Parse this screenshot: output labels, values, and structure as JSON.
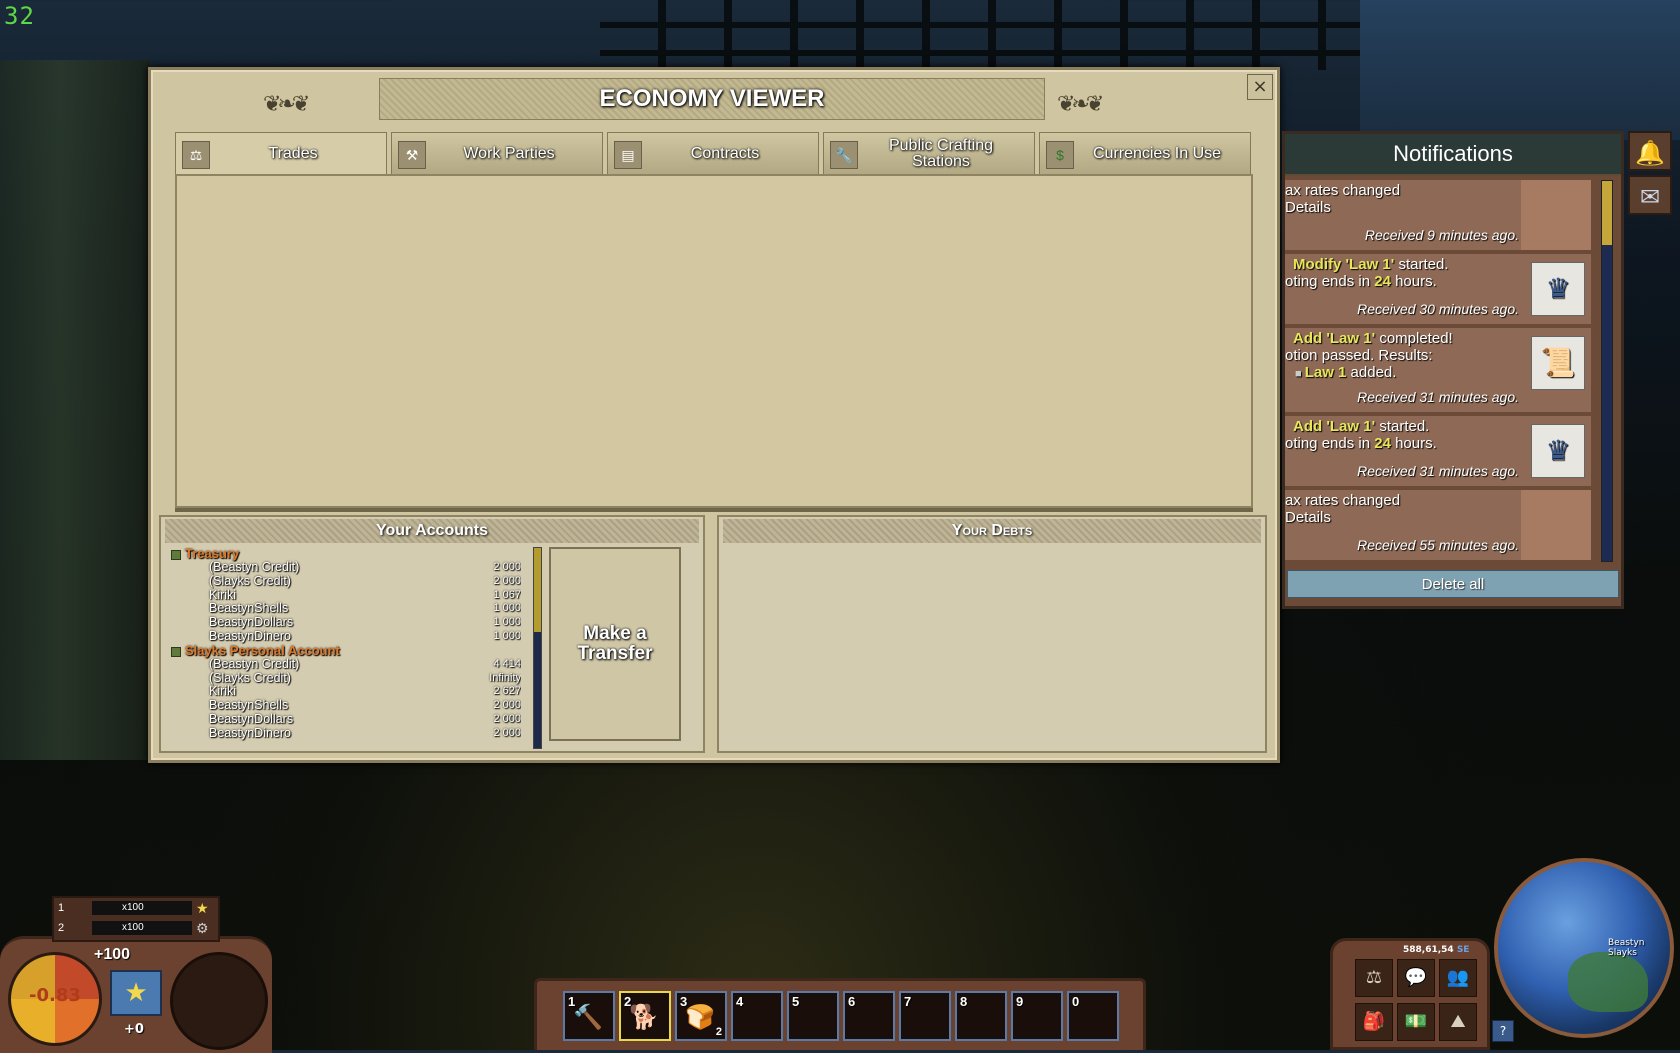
{
  "hud": {
    "fps": "32",
    "action_rows": [
      {
        "num": "1",
        "label": "x100"
      },
      {
        "num": "2",
        "label": "x100"
      }
    ],
    "stamina": "-0.83",
    "food": "+100",
    "reputation": "+0",
    "coords": "588,61,54",
    "coords_unit": "SE",
    "globe_label_1": "Beastyn",
    "globe_label_2": "Slayks",
    "help": "?"
  },
  "economy": {
    "title": "ECONOMY VIEWER",
    "close": "×",
    "tabs": [
      {
        "label": "Trades",
        "icon": "trades-icon"
      },
      {
        "label": "Work Parties",
        "icon": "work-parties-icon"
      },
      {
        "label": "Contracts",
        "icon": "contracts-icon"
      },
      {
        "label": "Public Crafting Stations",
        "icon": "wrench-icon"
      },
      {
        "label": "Currencies In Use",
        "icon": "dollar-icon"
      }
    ],
    "accounts": {
      "header": "Your Accounts",
      "groups": [
        {
          "name": "Treasury",
          "rows": [
            {
              "currency": "(Beastyn Credit)",
              "amount": "2 000"
            },
            {
              "currency": "(Slayks Credit)",
              "amount": "2 000"
            },
            {
              "currency": "Kiriki",
              "amount": "1 067"
            },
            {
              "currency": "BeastynShells",
              "amount": "1 000"
            },
            {
              "currency": "BeastynDollars",
              "amount": "1 000"
            },
            {
              "currency": "BeastynDinero",
              "amount": "1 000"
            }
          ]
        },
        {
          "name": "Slayks Personal Account",
          "rows": [
            {
              "currency": "(Beastyn Credit)",
              "amount": "4 414"
            },
            {
              "currency": "(Slayks Credit)",
              "amount": "Infinity"
            },
            {
              "currency": "Kiriki",
              "amount": "2 627"
            },
            {
              "currency": "BeastynShells",
              "amount": "2 000"
            },
            {
              "currency": "BeastynDollars",
              "amount": "2 000"
            },
            {
              "currency": "BeastynDinero",
              "amount": "2 000"
            }
          ]
        }
      ],
      "transfer_line1": "Make a",
      "transfer_line2": "Transfer"
    },
    "debts": {
      "header": "Your Debts"
    }
  },
  "notifications": {
    "title": "Notifications",
    "items": [
      {
        "line1": "ax rates changed",
        "line2": "Details",
        "time": "Received 9 minutes ago."
      },
      {
        "line1_hl": "Modify 'Law 1'",
        "line1": " started.",
        "line2": "oting ends in ",
        "line2_hl": "24",
        "line2_end": " hours.",
        "time": "Received 30 minutes ago."
      },
      {
        "line1_hl": "Add 'Law 1'",
        "line1": " completed!",
        "line2": "otion passed. Results:",
        "line3_hl": "Law 1",
        "line3": " added.",
        "time": "Received 31 minutes ago."
      },
      {
        "line1_hl": "Add 'Law 1'",
        "line1": " started.",
        "line2": "oting ends in ",
        "line2_hl": "24",
        "line2_end": " hours.",
        "time": "Received 31 minutes ago."
      },
      {
        "line1": "ax rates changed",
        "line2": "Details",
        "time": "Received 55 minutes ago."
      }
    ],
    "delete_all": "Delete all"
  },
  "hotbar": {
    "slots": [
      {
        "num": "1",
        "icon": "hammer-icon",
        "count": ""
      },
      {
        "num": "2",
        "icon": "animal-icon",
        "count": ""
      },
      {
        "num": "3",
        "icon": "bread-icon",
        "count": "2"
      },
      {
        "num": "4",
        "icon": "",
        "count": ""
      },
      {
        "num": "5",
        "icon": "",
        "count": ""
      },
      {
        "num": "6",
        "icon": "",
        "count": ""
      },
      {
        "num": "7",
        "icon": "",
        "count": ""
      },
      {
        "num": "8",
        "icon": "",
        "count": ""
      },
      {
        "num": "9",
        "icon": "",
        "count": ""
      },
      {
        "num": "0",
        "icon": "",
        "count": ""
      }
    ],
    "selected": "2"
  }
}
